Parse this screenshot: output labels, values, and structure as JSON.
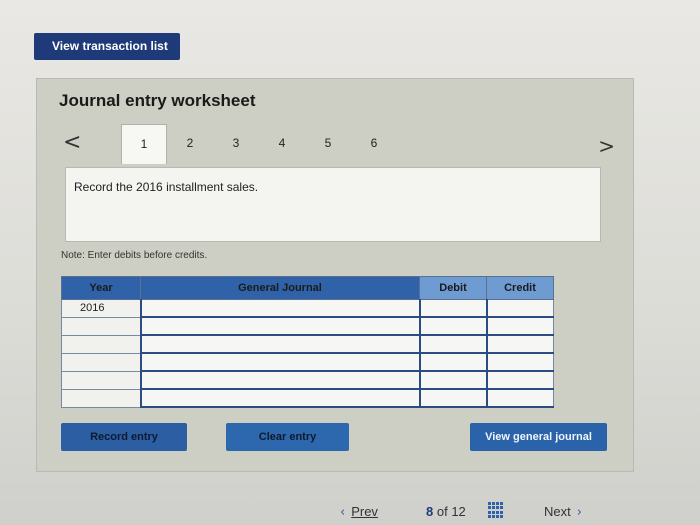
{
  "top_button": {
    "label": "View transaction list"
  },
  "worksheet": {
    "title": "Journal entry worksheet",
    "nav_left": "<",
    "nav_right": ">",
    "tabs": [
      "1",
      "2",
      "3",
      "4",
      "5",
      "6"
    ],
    "active_tab": "1",
    "instruction": "Record the 2016 installment sales.",
    "note": "Note: Enter debits before credits."
  },
  "journal_table": {
    "headers": {
      "year": "Year",
      "general_journal": "General Journal",
      "debit": "Debit",
      "credit": "Credit"
    },
    "rows": [
      {
        "year": "2016",
        "account": "",
        "debit": "",
        "credit": ""
      },
      {
        "year": "",
        "account": "",
        "debit": "",
        "credit": ""
      },
      {
        "year": "",
        "account": "",
        "debit": "",
        "credit": ""
      },
      {
        "year": "",
        "account": "",
        "debit": "",
        "credit": ""
      },
      {
        "year": "",
        "account": "",
        "debit": "",
        "credit": ""
      },
      {
        "year": "",
        "account": "",
        "debit": "",
        "credit": ""
      }
    ]
  },
  "actions": {
    "record": "Record entry",
    "clear": "Clear entry",
    "view_general": "View general journal"
  },
  "pager": {
    "prev_label": "Prev",
    "current": "8",
    "of_label": "of",
    "total": "12",
    "next_label": "Next"
  },
  "colors": {
    "accent_dark": "#1f3a78",
    "header_blue": "#2f62a8",
    "panel_bg": "#cdcfc4"
  }
}
